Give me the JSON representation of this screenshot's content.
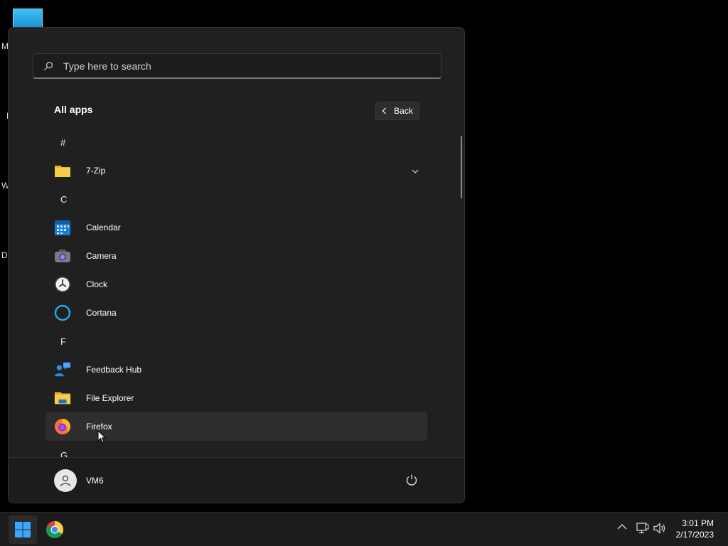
{
  "desktop": {
    "icon_letters": [
      "M",
      "F",
      "W",
      "Da"
    ]
  },
  "start_menu": {
    "search": {
      "placeholder": "Type here to search"
    },
    "section_title": "All apps",
    "back_label": "Back",
    "list": [
      {
        "type": "letter",
        "label": "#"
      },
      {
        "type": "app",
        "label": "7-Zip",
        "icon": "folder-icon",
        "expandable": true
      },
      {
        "type": "letter",
        "label": "C"
      },
      {
        "type": "app",
        "label": "Calendar",
        "icon": "calendar-icon"
      },
      {
        "type": "app",
        "label": "Camera",
        "icon": "camera-icon"
      },
      {
        "type": "app",
        "label": "Clock",
        "icon": "clock-icon"
      },
      {
        "type": "app",
        "label": "Cortana",
        "icon": "cortana-icon"
      },
      {
        "type": "letter",
        "label": "F"
      },
      {
        "type": "app",
        "label": "Feedback Hub",
        "icon": "feedback-hub-icon"
      },
      {
        "type": "app",
        "label": "File Explorer",
        "icon": "file-explorer-icon"
      },
      {
        "type": "app",
        "label": "Firefox",
        "icon": "firefox-icon",
        "hovered": true
      },
      {
        "type": "letter",
        "label": "G"
      }
    ],
    "user": {
      "name": "VM6"
    }
  },
  "taskbar": {
    "time": "3:01 PM",
    "date": "2/17/2023"
  },
  "colors": {
    "menu_bg": "#202020",
    "footer_bg": "#1c1c1c",
    "accent": "#0078d4",
    "hover": "#2e2e2e"
  }
}
